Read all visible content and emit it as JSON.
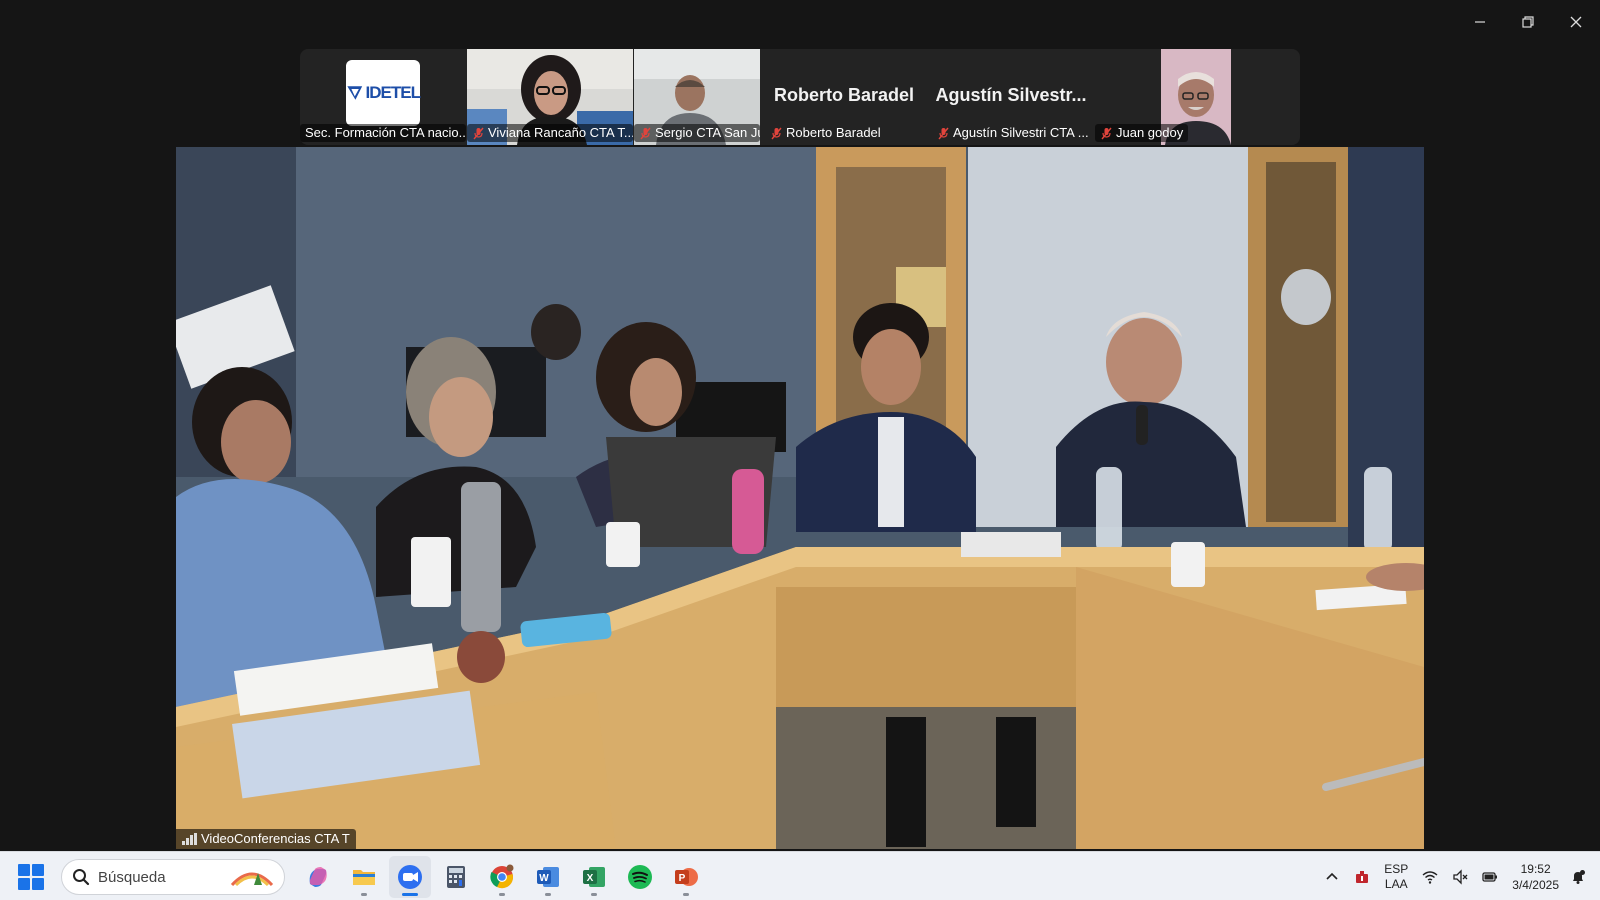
{
  "window": {
    "controls": [
      "minimize",
      "restore",
      "close"
    ]
  },
  "participants": [
    {
      "name": "Sec. Formación CTA nacio...",
      "kind": "logo",
      "logo_text": "IDETEL",
      "muted": false
    },
    {
      "name": "Viviana Rancaño CTA T...",
      "kind": "video",
      "muted": true
    },
    {
      "name": "Sergio CTA San Juan",
      "kind": "video",
      "muted": true
    },
    {
      "name": "Roberto Baradel",
      "kind": "name",
      "big_name": "Roberto Baradel",
      "muted": true
    },
    {
      "name": "Agustín Silvestri CTA ...",
      "kind": "name",
      "big_name": "Agustín  Silvestr...",
      "muted": true
    },
    {
      "name": "Juan godoy",
      "kind": "video",
      "muted": true
    }
  ],
  "main_video": {
    "label": "VideoConferencias CTA T"
  },
  "taskbar": {
    "search_placeholder": "Búsqueda",
    "apps": [
      {
        "name": "copilot",
        "icon": "copilot-icon",
        "active": false,
        "running": false
      },
      {
        "name": "file-explorer",
        "icon": "folder-icon",
        "active": false,
        "running": true
      },
      {
        "name": "zoom",
        "icon": "zoom-icon",
        "active": true,
        "running": true
      },
      {
        "name": "calculator",
        "icon": "calculator-icon",
        "active": false,
        "running": false
      },
      {
        "name": "chrome",
        "icon": "chrome-icon",
        "active": false,
        "running": true
      },
      {
        "name": "word",
        "icon": "word-icon",
        "active": false,
        "running": true
      },
      {
        "name": "excel",
        "icon": "excel-icon",
        "active": false,
        "running": true
      },
      {
        "name": "spotify",
        "icon": "spotify-icon",
        "active": false,
        "running": false
      },
      {
        "name": "powerpoint",
        "icon": "powerpoint-icon",
        "active": false,
        "running": true
      }
    ],
    "language": "ESP",
    "layout": "LAA",
    "time": "19:52",
    "date": "3/4/2025"
  },
  "colors": {
    "accent": "#1a73e8",
    "mic_muted": "#e0443c",
    "taskbar_bg": "#eef1f6"
  }
}
